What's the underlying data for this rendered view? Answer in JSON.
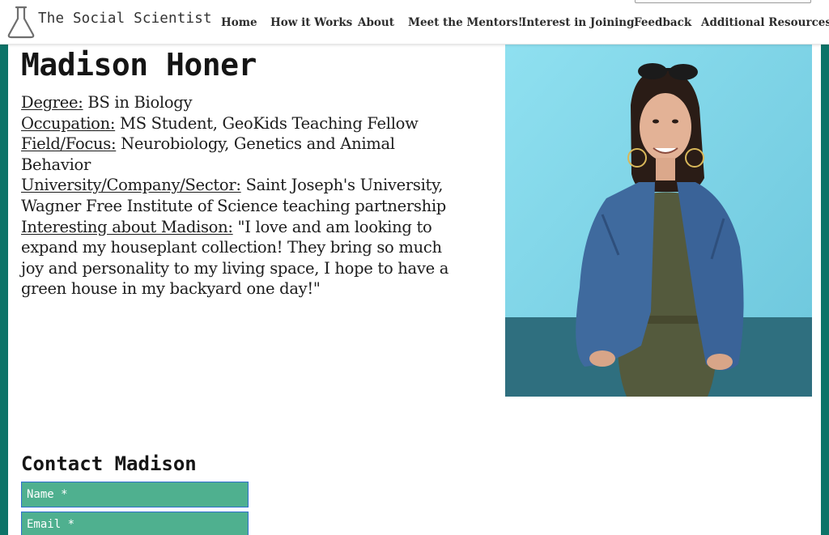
{
  "site": {
    "logo_text": "The Social Scientist",
    "logo_icon": "flask-icon"
  },
  "nav": {
    "items": [
      {
        "label": "Home"
      },
      {
        "label": "How it Works"
      },
      {
        "label": "About"
      },
      {
        "label": "Meet the Mentors!"
      },
      {
        "label": "Interest in Joining"
      },
      {
        "label": "Feedback"
      },
      {
        "label": "Additional Resources"
      }
    ]
  },
  "profile": {
    "name": "Madison Honer",
    "degree_label": "Degree:",
    "degree": " BS in Biology",
    "occupation_label": "Occupation:",
    "occupation": " MS Student, GeoKids Teaching Fellow",
    "field_label": "Field/Focus:",
    "field": " Neurobiology, Genetics and Animal Behavior",
    "university_label": "University/Company/Sector:",
    "university": " Saint Joseph's University, Wagner Free Institute of Science teaching partnership",
    "interesting_label": "Interesting about Madison:",
    "interesting": " \"I love and am looking to expand my houseplant collection! They bring so much joy and personality to my living space, I hope to have a green house in my backyard one day!\""
  },
  "contact": {
    "title": "Contact Madison",
    "name_placeholder": "Name *",
    "email_placeholder": "Email *"
  },
  "colors": {
    "accent": "#0d7368",
    "field_bg": "#4fb08f",
    "field_border": "#2f6fd0",
    "photo_wall": "#86d7ea"
  }
}
